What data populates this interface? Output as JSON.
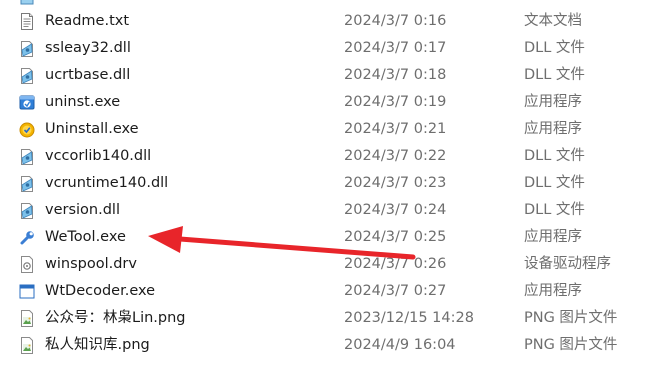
{
  "rows": [
    {
      "name": "Readme.txt",
      "date": "2024/3/7 0:16",
      "type": "文本文档",
      "icon": "text-file-icon"
    },
    {
      "name": "ssleay32.dll",
      "date": "2024/3/7 0:17",
      "type": "DLL 文件",
      "icon": "dll-file-icon"
    },
    {
      "name": "ucrtbase.dll",
      "date": "2024/3/7 0:18",
      "type": "DLL 文件",
      "icon": "dll-file-icon"
    },
    {
      "name": "uninst.exe",
      "date": "2024/3/7 0:19",
      "type": "应用程序",
      "icon": "installer-app-icon"
    },
    {
      "name": "Uninstall.exe",
      "date": "2024/3/7 0:21",
      "type": "应用程序",
      "icon": "uninstall-app-icon"
    },
    {
      "name": "vccorlib140.dll",
      "date": "2024/3/7 0:22",
      "type": "DLL 文件",
      "icon": "dll-file-icon"
    },
    {
      "name": "vcruntime140.dll",
      "date": "2024/3/7 0:23",
      "type": "DLL 文件",
      "icon": "dll-file-icon"
    },
    {
      "name": "version.dll",
      "date": "2024/3/7 0:24",
      "type": "DLL 文件",
      "icon": "dll-file-icon"
    },
    {
      "name": "WeTool.exe",
      "date": "2024/3/7 0:25",
      "type": "应用程序",
      "icon": "wrench-app-icon"
    },
    {
      "name": "winspool.drv",
      "date": "2024/3/7 0:26",
      "type": "设备驱动程序",
      "icon": "driver-file-icon"
    },
    {
      "name": "WtDecoder.exe",
      "date": "2024/3/7 0:27",
      "type": "应用程序",
      "icon": "window-app-icon"
    },
    {
      "name": "公众号：林枭Lin.png",
      "date": "2023/12/15 14:28",
      "type": "PNG 图片文件",
      "icon": "png-image-icon"
    },
    {
      "name": "私人知识库.png",
      "date": "2024/4/9 16:04",
      "type": "PNG 图片文件",
      "icon": "png-image-icon"
    }
  ],
  "annotation": {
    "arrow_color": "#e8252a"
  }
}
